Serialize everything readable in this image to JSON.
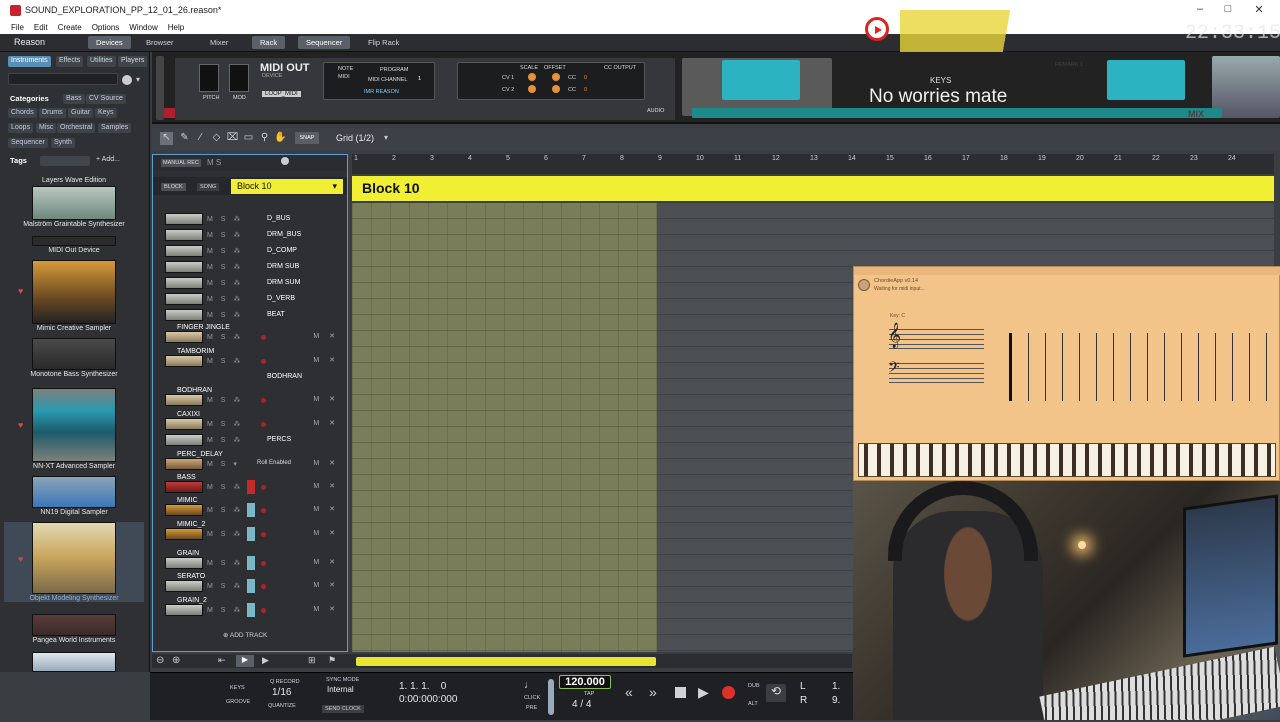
{
  "window": {
    "title": "SOUND_EXPLORATION_PP_12_01_26.reason*"
  },
  "menu": [
    "File",
    "Edit",
    "Create",
    "Options",
    "Window",
    "Help"
  ],
  "nav": {
    "logo": "Reason",
    "tabs": [
      "Devices",
      "Browser",
      "Mixer",
      "Rack",
      "Sequencer",
      "Flip Rack"
    ]
  },
  "sidebar": {
    "tabs": [
      "Instruments",
      "Effects",
      "Utilities",
      "Players"
    ],
    "categories_label": "Categories",
    "categories": [
      "Bass",
      "CV Source",
      "Chords",
      "Drums",
      "Guitar",
      "Keys",
      "Loops",
      "Misc",
      "Orchestral",
      "Samples",
      "Sequencer",
      "Synth"
    ],
    "tags_label": "Tags",
    "add_tag": "+ Add...",
    "devices": [
      "Layers Wave Edition",
      "Malström Graintable Synthesizer",
      "MIDI Out Device",
      "Mimic Creative Sampler",
      "Monotone Bass Synthesizer",
      "NN-XT Advanced Sampler",
      "NN19 Digital Sampler",
      "Objekt Modeling Synthesizer",
      "Pangea World Instruments"
    ]
  },
  "rack": {
    "midi_out_title": "MIDI OUT",
    "midi_out_sub": "DEVICE",
    "loop_midi": "LOOP_MIDI",
    "note": "NOTE",
    "midi": "MIDI",
    "program": "PROGRAM",
    "midi_channel": "MIDI CHANNEL",
    "channel": "1",
    "scale": "SCALE",
    "offset": "OFFSET",
    "cc_output": "CC OUTPUT",
    "cv1": "CV 1",
    "cv2": "CV 2",
    "cc": "CC",
    "cc_val": "0",
    "pitch": "PITCH",
    "mod": "MOD",
    "audio": "AUDIO",
    "keys_label": "KEYS",
    "remark": "REMARK 1",
    "mix": "MIX",
    "device_select": "IMR REASON"
  },
  "toolbar": {
    "snap": "SNAP",
    "grid": "Grid (1/2)"
  },
  "tracklist": {
    "manual_rec": "MANUAL REC",
    "block_btn": "BLOCK",
    "song_btn": "SONG",
    "block_name": "Block 10",
    "add_track": "ADD TRACK",
    "tracks": [
      "D_BUS",
      "DRM_BUS",
      "D_COMP",
      "DRM SUB",
      "DRM SUM",
      "D_VERB",
      "BEAT",
      "FINGER JINGLE",
      "TAMBORIM",
      "BODHRAN",
      "BODHRAN",
      "CAXIXI",
      "PERCS",
      "PERC_DELAY",
      "BASS",
      "MIMIC",
      "MIMIC_2",
      "GRAIN",
      "SERATO",
      "GRAIN_2"
    ],
    "roll_enabled": "Roll Enabled"
  },
  "ruler": {
    "bars": [
      "1",
      "2",
      "3",
      "4",
      "5",
      "6",
      "7",
      "8",
      "9",
      "10",
      "11",
      "12",
      "13",
      "14",
      "15",
      "16",
      "17",
      "18",
      "19",
      "20",
      "21",
      "22",
      "23",
      "24"
    ]
  },
  "sequencer": {
    "block_title": "Block 10"
  },
  "transport": {
    "keys": "KEYS",
    "groove": "GROOVE",
    "q_record": "Q RECORD",
    "quantize_value": "1/16",
    "quantize": "QUANTIZE",
    "sync_mode": "SYNC MODE",
    "sync_value": "Internal",
    "send_clock": "SEND CLOCK",
    "position": "1. 1. 1.    0",
    "time": "0:00:000:000",
    "click": "CLICK",
    "pre": "PRE",
    "tempo": "120.000",
    "tap": "TAP",
    "signature": "4 / 4",
    "dub": "DUB",
    "alt": "ALT",
    "l": "L",
    "r": "R",
    "loop_l": "1.",
    "loop_r": "9."
  },
  "overlay": {
    "caption": "No worries mate",
    "clock": "22:33:15",
    "chord_app_title": "ChordieApp v0.14",
    "chord_app_sub": "Waiting for midi input...",
    "key": "Key: C"
  }
}
